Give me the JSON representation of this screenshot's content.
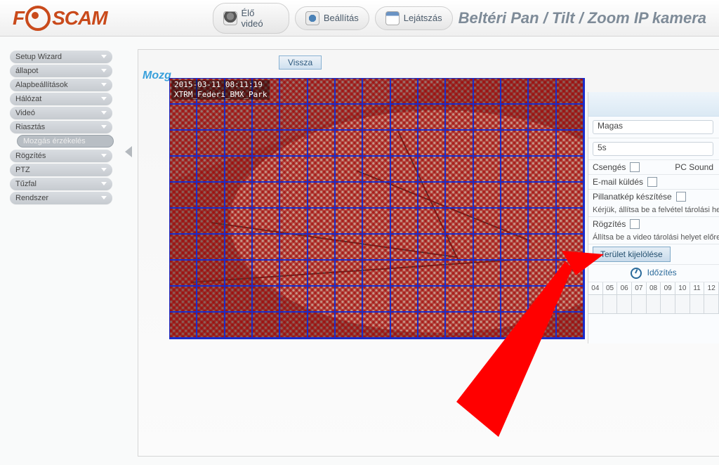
{
  "brand": "FOSCAM",
  "header": {
    "tabs": [
      {
        "id": "live",
        "label": "Élő videó"
      },
      {
        "id": "settings",
        "label": "Beállítás"
      },
      {
        "id": "playback",
        "label": "Lejátszás"
      }
    ],
    "title": "Beltéri Pan / Tilt / Zoom IP kamera"
  },
  "sidebar": {
    "items": [
      {
        "id": "setup-wizard",
        "label": "Setup Wizard"
      },
      {
        "id": "status",
        "label": "állapot"
      },
      {
        "id": "basic",
        "label": "Alapbeállítások"
      },
      {
        "id": "network",
        "label": "Hálózat"
      },
      {
        "id": "video",
        "label": "Videó"
      },
      {
        "id": "alarm",
        "label": "Riasztás",
        "children": [
          {
            "id": "motion",
            "label": "Mozgás érzékelés"
          }
        ]
      },
      {
        "id": "record",
        "label": "Rögzítés"
      },
      {
        "id": "ptz",
        "label": "PTZ"
      },
      {
        "id": "firewall",
        "label": "Tűzfal"
      },
      {
        "id": "system",
        "label": "Rendszer"
      }
    ]
  },
  "content": {
    "section_label_prefix": "Mozg",
    "back_button": "Vissza",
    "osd_line1": "2015-03-11 08:11:19",
    "osd_line2": "XTRM_Federi_BMX_Park",
    "grid": {
      "cols": 15,
      "rows": 10,
      "selected_not": []
    }
  },
  "settings": {
    "sensitivity_value": "Magas",
    "trigger_interval_value": "5s",
    "ring_label": "Csengés",
    "pcsound_label": "PC Sound",
    "email_label": "E-mail küldés",
    "snapshot_label": "Pillanatkép készítése",
    "snapshot_hint": "Kérjük, állítsa be a felvétel tárolási helyet",
    "record_label": "Rögzítés",
    "record_hint": "Állítsa be a video tárolási helyet előre.",
    "area_button": "Terület kijelölése",
    "schedule_label": "Időzítés",
    "hours": [
      "04",
      "05",
      "06",
      "07",
      "08",
      "09",
      "10",
      "11",
      "12"
    ]
  }
}
